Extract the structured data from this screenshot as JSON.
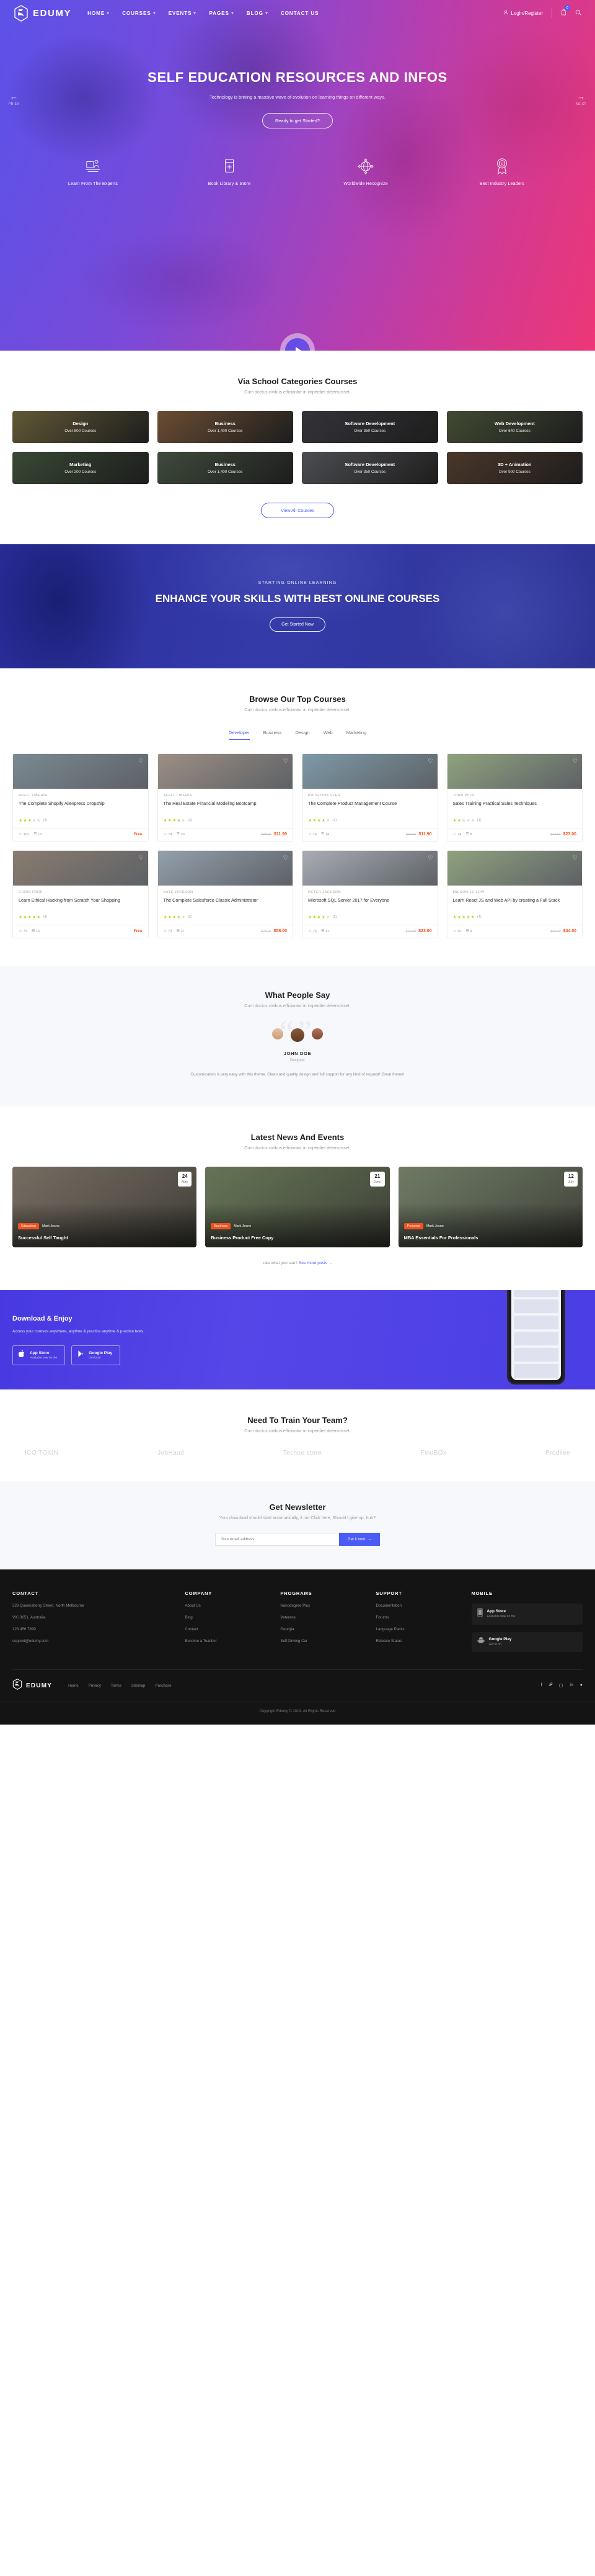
{
  "nav": {
    "brand": "EDUMY",
    "links": [
      {
        "label": "HOME",
        "caret": true
      },
      {
        "label": "COURSES",
        "caret": true
      },
      {
        "label": "EVENTS",
        "caret": true
      },
      {
        "label": "PAGES",
        "caret": true
      },
      {
        "label": "BLOG",
        "caret": true
      },
      {
        "label": "CONTACT US",
        "caret": false
      }
    ],
    "login": "Login/Register",
    "cart_count": "0"
  },
  "hero": {
    "title": "SELF EDUCATION RESOURCES AND INFOS",
    "subtitle": "Technology is brining a massive wave of evolution on learning things on different ways.",
    "cta": "Ready to get Started?",
    "prev": "PR EV",
    "next": "NE XT",
    "features": [
      {
        "icon": "presenter-icon",
        "label": "Learn From The Experts"
      },
      {
        "icon": "book-plus-icon",
        "label": "Book Library & Store"
      },
      {
        "icon": "globe-icon",
        "label": "Worldwide Recognize"
      },
      {
        "icon": "award-ribbon-icon",
        "label": "Best Industry Leaders"
      }
    ]
  },
  "categories": {
    "title": "Via School Categories Courses",
    "subtitle": "Cum doctus civibus efficiantur in imperdiet deterruisset.",
    "items": [
      {
        "name": "Design",
        "count": "Over 800 Courses",
        "color": "#8b7f4e"
      },
      {
        "name": "Business",
        "count": "Over 1,400 Courses",
        "color": "#9a6f4a"
      },
      {
        "name": "Software Development",
        "count": "Over 350 Courses",
        "color": "#4c4a52"
      },
      {
        "name": "Web Development",
        "count": "Over 640 Courses",
        "color": "#5e6b4a"
      },
      {
        "name": "Marketing",
        "count": "Over 200 Courses",
        "color": "#52694b"
      },
      {
        "name": "Business",
        "count": "Over 1,400 Courses",
        "color": "#5b6b57"
      },
      {
        "name": "Software Development",
        "count": "Over 350 Courses",
        "color": "#6e7076"
      },
      {
        "name": "3D + Animation",
        "count": "Over 900 Courses",
        "color": "#6a4f3c"
      }
    ],
    "view_all": "View All Courses"
  },
  "banner": {
    "kicker": "STARTING ONLINE LEARNING",
    "title": "ENHANCE YOUR SKILLS WITH BEST ONLINE COURSES",
    "cta": "Get Started Now"
  },
  "courses": {
    "title": "Browse Our Top Courses",
    "subtitle": "Cum doctus civibus efficiantur in imperdiet deterruisset.",
    "tabs": [
      "Developer",
      "Business",
      "Design",
      "Web",
      "Marketing"
    ],
    "active_tab": "Developer",
    "items": [
      {
        "author": "AFELL LIBERIA",
        "name": "The Complete Shopify Aliexpress Dropship",
        "rating": 2.5,
        "reviews": "(2)",
        "students": "162",
        "lessons": "16",
        "old_price": "",
        "price": "Free",
        "free": true,
        "img": "#7a8a92"
      },
      {
        "author": "AFELL LIBERIA",
        "name": "The Real Estate Financial Modeling Bootcamp",
        "rating": 4,
        "reviews": "(3)",
        "students": "74",
        "lessons": "10",
        "old_price": "$29.00",
        "price": "$11.90",
        "free": false,
        "img": "#9d8f84"
      },
      {
        "author": "KRISZTINA SZER",
        "name": "The Complete Product Management Course",
        "rating": 4,
        "reviews": "(1)",
        "students": "74",
        "lessons": "14",
        "old_price": "$29.00",
        "price": "$11.90",
        "free": false,
        "img": "#7d9aa8"
      },
      {
        "author": "JOHN WICK",
        "name": "Sales Training Practical Sales Techniques",
        "rating": 2,
        "reviews": "(1)",
        "students": "74",
        "lessons": "8",
        "old_price": "$34.00",
        "price": "$23.00",
        "free": false,
        "img": "#8fa37d"
      },
      {
        "author": "CHRIS PARK",
        "name": "Learn Ethical Hacking from Scratch Your Shopping",
        "rating": 4.5,
        "reviews": "(4)",
        "students": "74",
        "lessons": "15",
        "old_price": "",
        "price": "Free",
        "free": true,
        "img": "#8a7c70"
      },
      {
        "author": "KATE JACKSON",
        "name": "The Complete Salesforce Classic Administrator",
        "rating": 4,
        "reviews": "(2)",
        "students": "74",
        "lessons": "11",
        "old_price": "$78.00",
        "price": "$58.00",
        "free": false,
        "img": "#93a0ac"
      },
      {
        "author": "PETER JACKSON",
        "name": "Microsoft SQL Server 2017 for Everyone",
        "rating": 4,
        "reviews": "(1)",
        "students": "74",
        "lessons": "11",
        "old_price": "$29.00",
        "price": "$23.00",
        "free": false,
        "img": "#a8aeb4"
      },
      {
        "author": "MAISON LE LOW",
        "name": "Learn React JS and Web API by creating a Full Stack",
        "rating": 4.5,
        "reviews": "(4)",
        "students": "20",
        "lessons": "9",
        "old_price": "$69.00",
        "price": "$44.00",
        "free": false,
        "img": "#8fa27e"
      }
    ]
  },
  "testimonial": {
    "title": "What People Say",
    "subtitle": "Cum doctus civibus efficiantur in imperdiet deterruisset.",
    "name": "JOHN DOE",
    "role": "Designer",
    "text": "Customization is very easy with this theme. Clean and quality design and full support for any kind of request! Great theme!"
  },
  "news": {
    "title": "Latest News And Events",
    "subtitle": "Cum doctus civibus efficiantur in imperdiet deterruisset.",
    "items": [
      {
        "day": "24",
        "month": "May",
        "category": "Education",
        "meta": "Mark Jecno",
        "title": "Successful Self Taught",
        "img": "#8f8376"
      },
      {
        "day": "21",
        "month": "June",
        "category": "Business",
        "meta": "Mark Jecno",
        "title": "Business Product Free Copy",
        "img": "#7a8d68"
      },
      {
        "day": "12",
        "month": "July",
        "category": "Personal",
        "meta": "Mark Jecno",
        "title": "MBA Essentials For Professionals",
        "img": "#86957a"
      }
    ],
    "more_text": "Like what you see?",
    "more_link": "See more posts"
  },
  "app": {
    "title": "Download & Enjoy",
    "subtitle": "Access your courses anywhere, anytime & practice anytime & practice tests.",
    "stores": [
      {
        "icon": "apple-icon",
        "t1": "App Store",
        "t2": "Available now on the",
        "filled": false
      },
      {
        "icon": "google-play-icon",
        "t1": "Google Play",
        "t2": "Get in on",
        "filled": false
      }
    ]
  },
  "brands": {
    "title": "Need To Train Your Team?",
    "subtitle": "Cum doctus civibus efficiantur in imperdiet deterruisset.",
    "logos": [
      "ICO TOXIN",
      "JobHand",
      "Techno store",
      "FindBOx",
      "Prodilee"
    ]
  },
  "newsletter": {
    "title": "Get Newsletter",
    "subtitle": "Your download should start automatically, if not Click here, Should I give up, huh?",
    "placeholder": "Your email address",
    "button": "Get it now"
  },
  "footer": {
    "columns": [
      {
        "heading": "CONTACT",
        "items": [
          "329 Queensberry Street, North Melbourne",
          "VIC 3051, Australia.",
          "123 456 7890",
          "support@edumy.com"
        ],
        "static": true
      },
      {
        "heading": "COMPANY",
        "items": [
          "About Us",
          "Blog",
          "Contact",
          "Become a Teacher"
        ],
        "static": false
      },
      {
        "heading": "PROGRAMS",
        "items": [
          "Nanodegree Plus",
          "Veterans",
          "Georgia",
          "Self-Driving Car"
        ],
        "static": false
      },
      {
        "heading": "SUPPORT",
        "items": [
          "Documentation",
          "Forums",
          "Language Packs",
          "Release Status"
        ],
        "static": false
      }
    ],
    "mobile_heading": "MOBILE",
    "stores": [
      {
        "icon": "phone-icon",
        "t1": "App Store",
        "t2": "Available now on the"
      },
      {
        "icon": "android-icon",
        "t1": "Google Play",
        "t2": "Get in on"
      }
    ],
    "brand": "EDUMY",
    "links": [
      "Home",
      "Privacy",
      "Terms",
      "Sitemap",
      "Purchase"
    ],
    "socials": [
      "facebook-icon",
      "twitter-icon",
      "instagram-icon",
      "linkedin-icon",
      "pinterest-icon"
    ],
    "copyright": "Copyright Edumy © 2019. All Rights Reserved"
  }
}
